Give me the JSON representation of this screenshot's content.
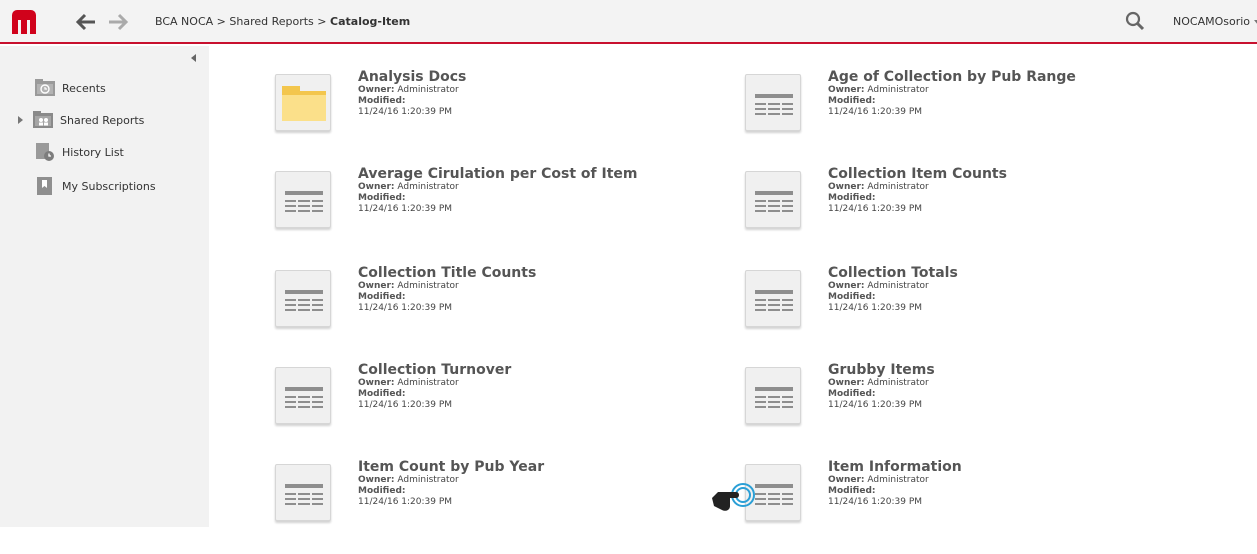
{
  "header": {
    "breadcrumb": {
      "root": "BCA NOCA",
      "sep1": ">",
      "parent": "Shared Reports",
      "sep2": ">",
      "current": "Catalog-Item"
    },
    "user": "NOCAMOsorio",
    "accent_color": "#c8102e"
  },
  "sidebar": {
    "items": [
      {
        "label": "Recents",
        "icon": "folder-clock-icon"
      },
      {
        "label": "Shared Reports",
        "icon": "folder-users-icon"
      },
      {
        "label": "History List",
        "icon": "history-list-icon"
      },
      {
        "label": "My Subscriptions",
        "icon": "bookmark-icon"
      }
    ]
  },
  "catalog": {
    "owner_label": "Owner:",
    "modified_label": "Modified:",
    "items": [
      {
        "title": "Analysis Docs",
        "owner": "Administrator",
        "modified": "11/24/16 1:20:39 PM",
        "type": "folder"
      },
      {
        "title": "Age of Collection by Pub Range",
        "owner": "Administrator",
        "modified": "11/24/16 1:20:39 PM",
        "type": "report"
      },
      {
        "title": "Average Cirulation per Cost of Item",
        "owner": "Administrator",
        "modified": "11/24/16 1:20:39 PM",
        "type": "report"
      },
      {
        "title": "Collection Item Counts",
        "owner": "Administrator",
        "modified": "11/24/16 1:20:39 PM",
        "type": "report"
      },
      {
        "title": "Collection Title Counts",
        "owner": "Administrator",
        "modified": "11/24/16 1:20:39 PM",
        "type": "report"
      },
      {
        "title": "Collection Totals",
        "owner": "Administrator",
        "modified": "11/24/16 1:20:39 PM",
        "type": "report"
      },
      {
        "title": "Collection Turnover",
        "owner": "Administrator",
        "modified": "11/24/16 1:20:39 PM",
        "type": "report"
      },
      {
        "title": "Grubby Items",
        "owner": "Administrator",
        "modified": "11/24/16 1:20:39 PM",
        "type": "report"
      },
      {
        "title": "Item Count by Pub Year",
        "owner": "Administrator",
        "modified": "11/24/16 1:20:39 PM",
        "type": "report"
      },
      {
        "title": "Item Information",
        "owner": "Administrator",
        "modified": "11/24/16 1:20:39 PM",
        "type": "report"
      }
    ]
  }
}
